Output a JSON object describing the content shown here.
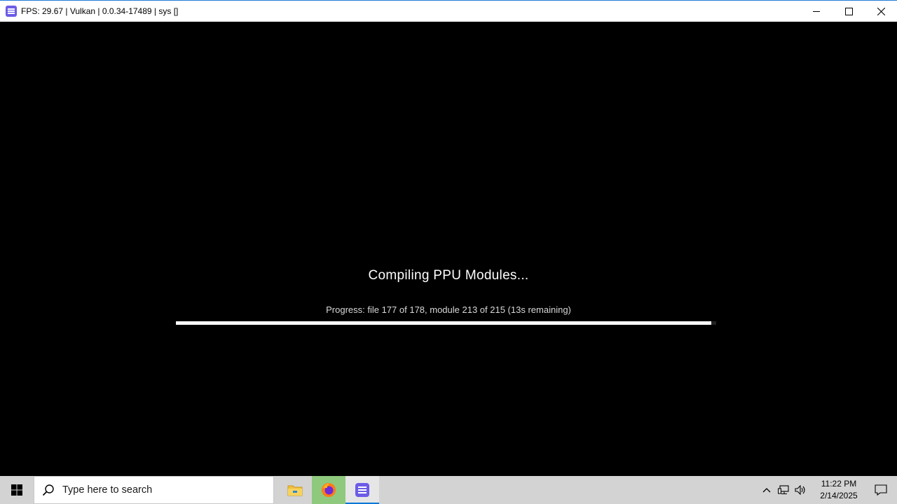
{
  "window": {
    "title": "FPS: 29.67 | Vulkan | 0.0.34-17489 | sys []",
    "app_icon": "rpcs3-icon",
    "controls": [
      "minimize-icon",
      "maximize-icon",
      "close-icon"
    ]
  },
  "loading": {
    "heading": "Compiling PPU Modules...",
    "progress_text": "Progress: file 177 of 178, module 213 of 215 (13s remaining)",
    "progress_fraction": 0.991
  },
  "taskbar": {
    "search_placeholder": "Type here to search",
    "apps": [
      "file-explorer-icon",
      "firefox-icon",
      "rpcs3-icon"
    ],
    "clock_time": "11:22 PM",
    "clock_date": "2/14/2025"
  },
  "colors": {
    "accent": "#0078d7",
    "app_icon_bg": "#6c5ce7",
    "firefox_highlight": "#8fc97e"
  }
}
